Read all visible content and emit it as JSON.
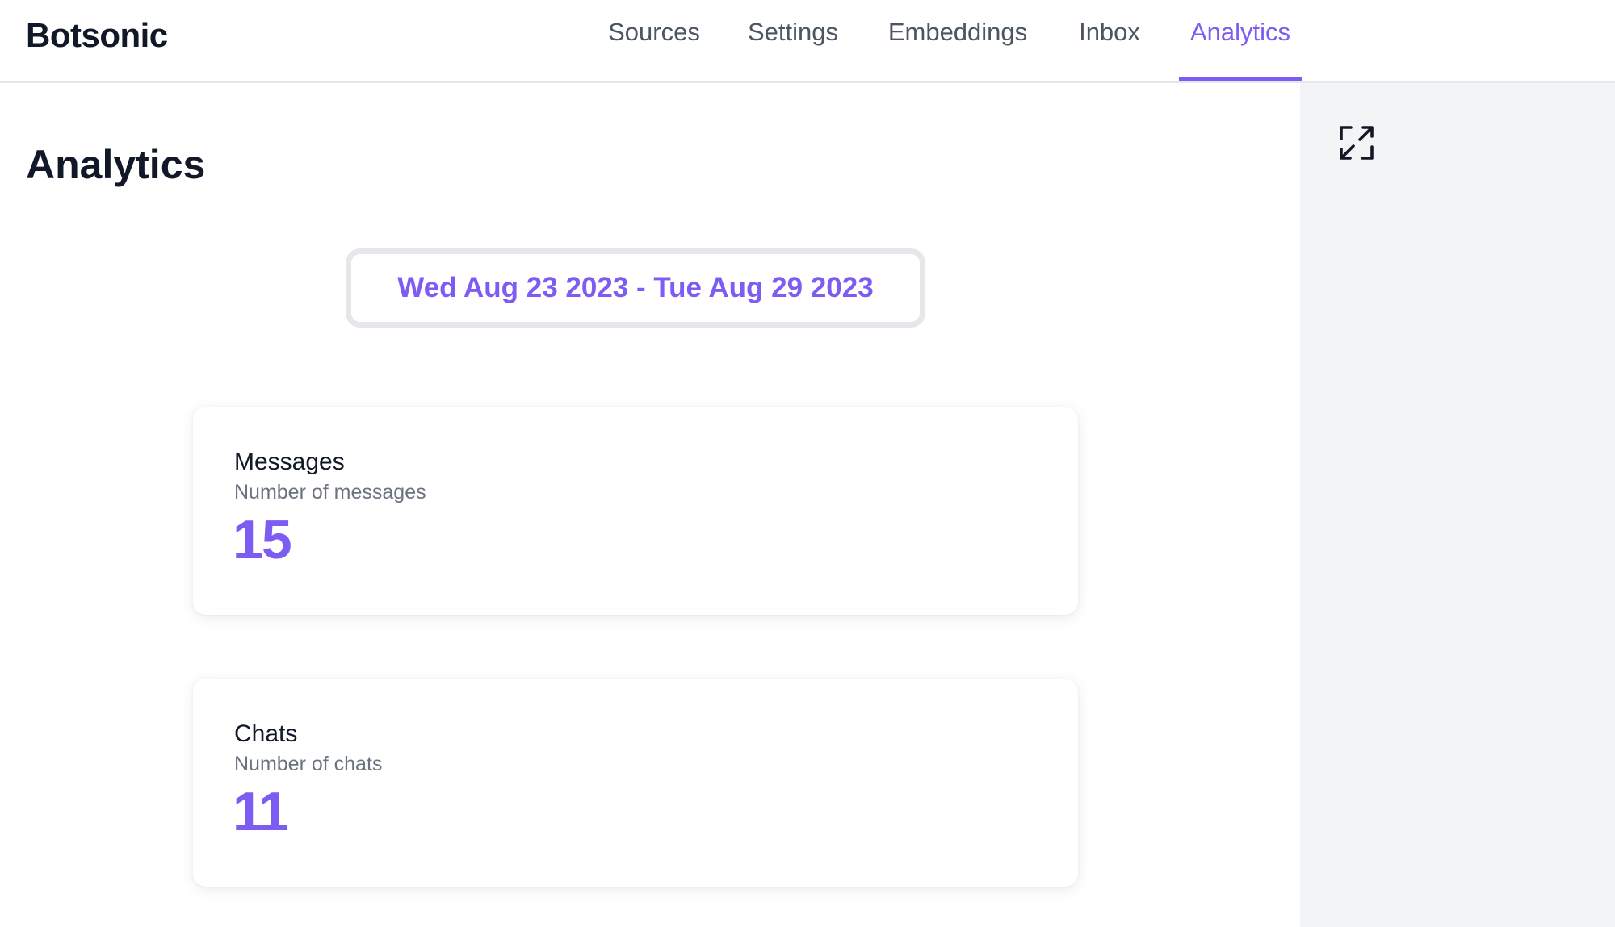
{
  "brand": "Botsonic",
  "nav": {
    "tabs": [
      {
        "label": "Sources"
      },
      {
        "label": "Settings"
      },
      {
        "label": "Embeddings"
      },
      {
        "label": "Inbox"
      },
      {
        "label": "Analytics"
      }
    ],
    "active": "Analytics"
  },
  "main": {
    "title": "Analytics",
    "date_range": "Wed Aug 23 2023 - Tue Aug 29 2023",
    "cards": [
      {
        "title": "Messages",
        "subtitle": "Number of messages",
        "value": "15"
      },
      {
        "title": "Chats",
        "subtitle": "Number of chats",
        "value": "11"
      }
    ]
  },
  "side_panel": {
    "expand_icon": "expand-icon"
  },
  "colors": {
    "accent": "#7c5cf2",
    "text": "#111827",
    "muted": "#6b7280",
    "panel_bg": "#f3f4f6",
    "border": "#e5e7eb"
  }
}
